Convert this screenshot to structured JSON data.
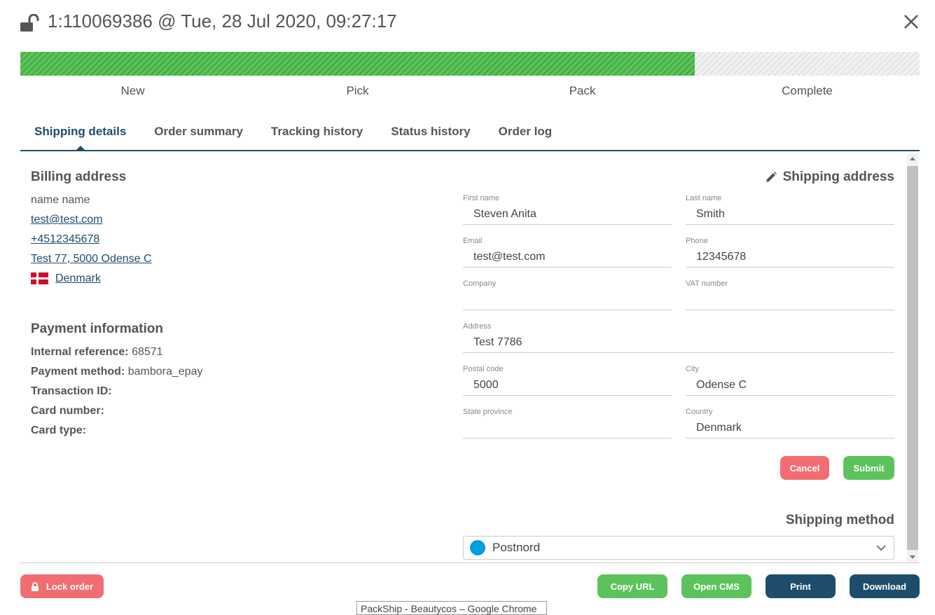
{
  "header": {
    "title": "1:110069386 @ Tue, 28 Jul 2020, 09:27:17"
  },
  "progress": {
    "fraction": 0.75,
    "fill_color": "#4cbb4c",
    "steps": [
      "New",
      "Pick",
      "Pack",
      "Complete"
    ]
  },
  "tabs": [
    "Shipping details",
    "Order summary",
    "Tracking history",
    "Status history",
    "Order log"
  ],
  "billing": {
    "title": "Billing address",
    "name": "name name",
    "email": "test@test.com",
    "phone": "+4512345678",
    "address": "Test 77, 5000 Odense C",
    "country": "Denmark"
  },
  "payment": {
    "title": "Payment information",
    "internal_reference_label": "Internal reference:",
    "internal_reference": "68571",
    "payment_method_label": "Payment method:",
    "payment_method": "bambora_epay",
    "transaction_id_label": "Transaction ID:",
    "card_number_label": "Card number:",
    "card_type_label": "Card type:"
  },
  "shipping": {
    "title": "Shipping address",
    "fields": {
      "first_name": {
        "label": "First name",
        "value": "Steven Anita"
      },
      "last_name": {
        "label": "Last name",
        "value": "Smith"
      },
      "email": {
        "label": "Email",
        "value": "test@test.com"
      },
      "phone": {
        "label": "Phone",
        "value": "12345678"
      },
      "company": {
        "label": "Company",
        "value": ""
      },
      "vat": {
        "label": "VAT number",
        "value": ""
      },
      "address": {
        "label": "Address",
        "value": "Test 7786"
      },
      "postal": {
        "label": "Postal code",
        "value": "5000"
      },
      "city": {
        "label": "City",
        "value": "Odense C"
      },
      "state": {
        "label": "State province",
        "value": ""
      },
      "country": {
        "label": "Country",
        "value": "Denmark"
      }
    },
    "cancel_label": "Cancel",
    "submit_label": "Submit"
  },
  "shipping_method": {
    "title": "Shipping method",
    "selected": "Postnord"
  },
  "footer": {
    "lock_label": "Lock order",
    "copy_url_label": "Copy URL",
    "open_cms_label": "Open CMS",
    "print_label": "Print",
    "download_label": "Download"
  },
  "tooltip": "PackShip - Beautycos – Google Chrome",
  "colors": {
    "accent": "#1e4d6b",
    "green": "#5cc35c",
    "red": "#f26d72"
  }
}
